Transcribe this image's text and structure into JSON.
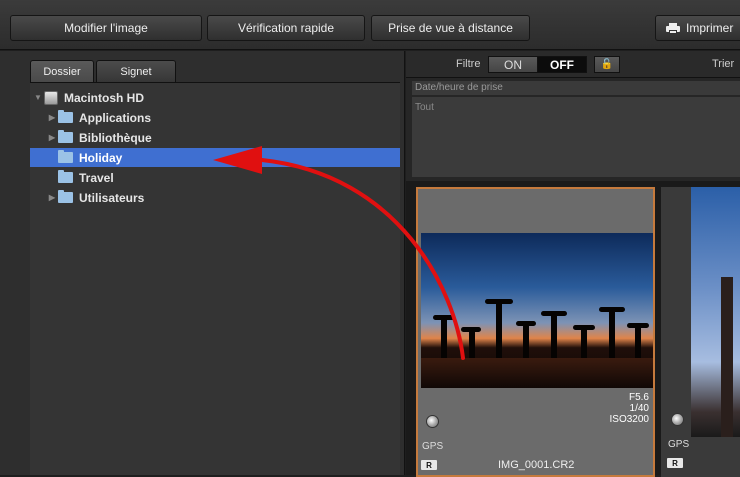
{
  "toolbar": {
    "edit_image": "Modifier l'image",
    "quick_check": "Vérification rapide",
    "remote_shooting": "Prise de vue à distance",
    "print": "Imprimer"
  },
  "left_panel": {
    "tabs": [
      {
        "label": "Dossier",
        "active": true
      },
      {
        "label": "Signet",
        "active": false
      }
    ],
    "tree": [
      {
        "label": "Macintosh HD",
        "icon": "hard-drive-icon",
        "expanded": true
      },
      {
        "label": "Applications",
        "icon": "folder-icon",
        "expandable": true
      },
      {
        "label": "Bibliothèque",
        "icon": "folder-icon",
        "expandable": true
      },
      {
        "label": "Holiday",
        "icon": "folder-icon",
        "selected": true
      },
      {
        "label": "Travel",
        "icon": "folder-icon"
      },
      {
        "label": "Utilisateurs",
        "icon": "folder-icon",
        "expandable": true
      }
    ]
  },
  "filter": {
    "label": "Filtre",
    "on": "ON",
    "off": "OFF",
    "sort_label": "Trier",
    "date_header": "Date/heure de prise",
    "all": "Tout"
  },
  "thumbnails": [
    {
      "filename": "IMG_0001.CR2",
      "aperture": "F5.6",
      "shutter": "1/40",
      "iso": "ISO3200",
      "gps": "GPS",
      "raw_badge": "R",
      "selected": true
    },
    {
      "gps": "GPS",
      "raw_badge": "R"
    }
  ],
  "colors": {
    "selection": "#3f6fd1",
    "thumbnail_border": "#c57a3d",
    "arrow": "#e01010"
  }
}
